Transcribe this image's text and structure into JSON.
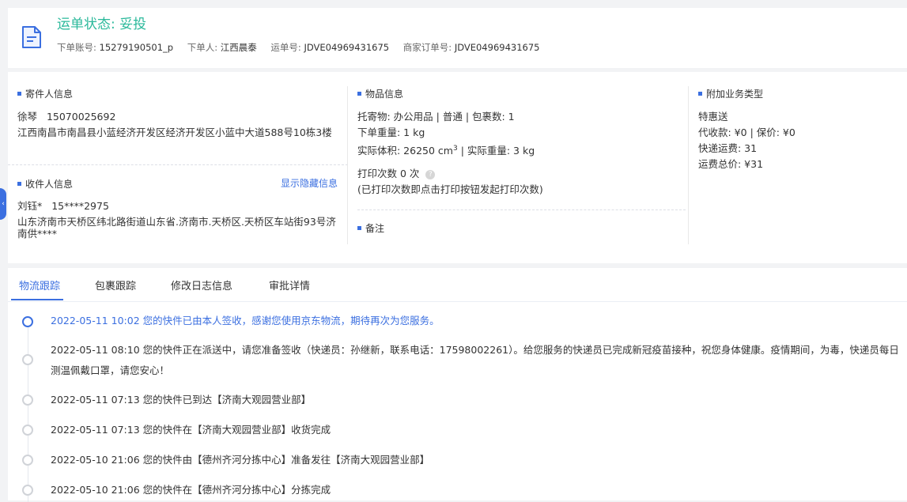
{
  "header": {
    "status_label": "运单状态:",
    "status_value": "妥投",
    "meta": [
      {
        "key": "下单账号:",
        "value": "15279190501_p"
      },
      {
        "key": "下单人:",
        "value": "江西晨泰"
      },
      {
        "key": "运单号:",
        "value": "JDVE04969431675"
      },
      {
        "key": "商家订单号:",
        "value": "JDVE04969431675"
      }
    ]
  },
  "sender": {
    "title": "寄件人信息",
    "name": "徐琴",
    "phone": "15070025692",
    "address": "江西南昌市南昌县小蓝经济开发区经济开发区小蓝中大道588号10栋3楼"
  },
  "receiver": {
    "title": "收件人信息",
    "show_hidden": "显示隐藏信息",
    "name": "刘钰*",
    "phone": "15****2975",
    "address": "山东济南市天桥区纬北路街道山东省.济南市.天桥区.天桥区车站街93号济南供****"
  },
  "goods": {
    "title": "物品信息",
    "line1": "托寄物:  办公用品 | 普通  |  包裹数:  1",
    "order_weight": "下单重量:   1 kg",
    "volume_label": "实际体积:    26250 cm",
    "volume_sup": "3",
    "actual_weight": " | 实际重量:   3 kg",
    "print_count": "打印次数   0 次",
    "print_hint": "(已打印次数即点击打印按钮发起打印次数)",
    "help_glyph": "?"
  },
  "remark": {
    "title": "备注"
  },
  "extra": {
    "title": "附加业务类型",
    "product": "特惠送",
    "cod": "代收款:  ¥0  |  保价:  ¥0",
    "fee": "快递运费:   31",
    "total": "运费总价:   ¥31"
  },
  "tabs": [
    "物流跟踪",
    "包裹跟踪",
    "修改日志信息",
    "审批详情"
  ],
  "tracking": [
    "2022-05-11 10:02 您的快件已由本人签收，感谢您使用京东物流，期待再次为您服务。",
    "2022-05-11 08:10 您的快件正在派送中，请您准备签收（快递员：孙继新，联系电话：17598002261）。给您服务的快递员已完成新冠疫苗接种，祝您身体健康。疫情期间，为毒，快递员每日测温佩戴口罩，请您安心！",
    "2022-05-11 07:13 您的快件已到达【济南大观园营业部】",
    "2022-05-11 07:13 您的快件在【济南大观园营业部】收货完成",
    "2022-05-10 21:06 您的快件由【德州齐河分拣中心】准备发往【济南大观园营业部】",
    "2022-05-10 21:06 您的快件在【德州齐河分拣中心】分拣完成"
  ],
  "colors": {
    "accent": "#3b6fe0",
    "status": "#2bb99b"
  }
}
